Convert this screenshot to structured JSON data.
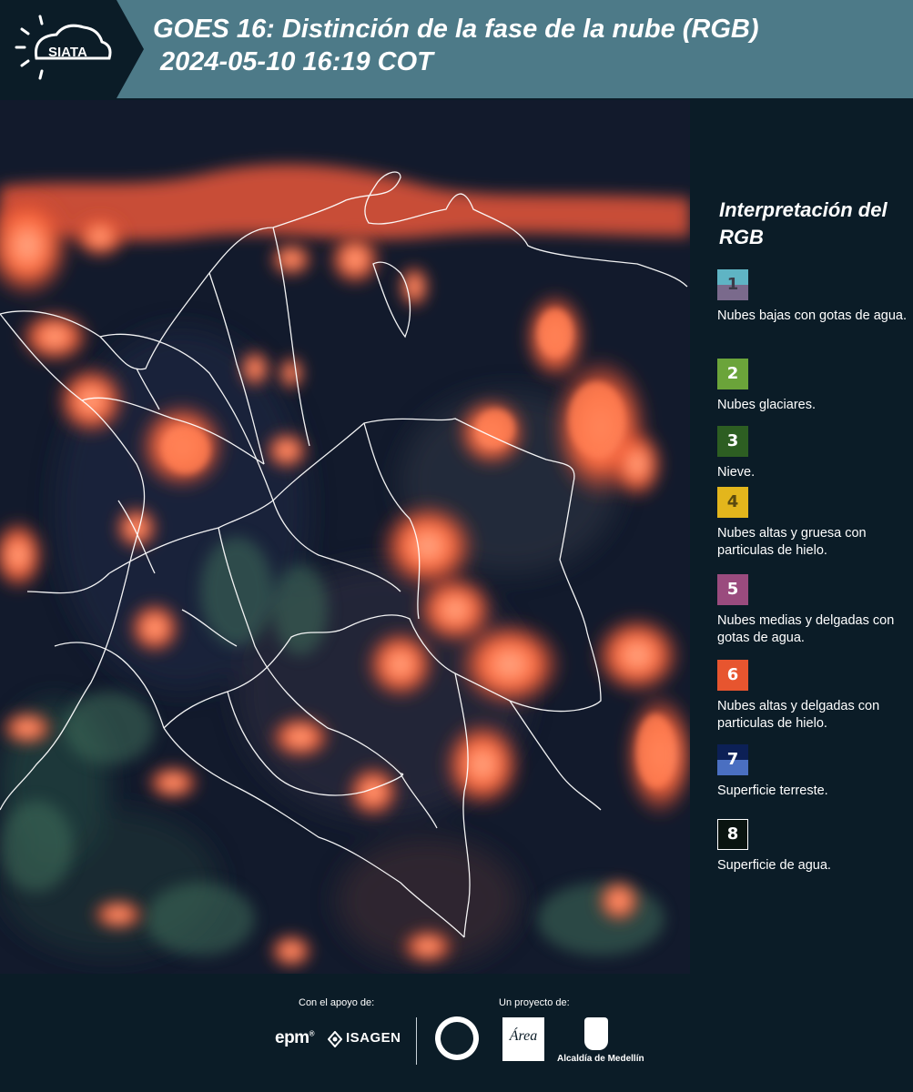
{
  "header": {
    "logo_text": "SIATA",
    "title_line1": "GOES 16: Distinción de la fase de la nube (RGB)",
    "title_line2": "2024-05-10 16:19 COT"
  },
  "legend": {
    "title": "Interpretación del RGB",
    "items": [
      {
        "number": "1",
        "label": "Nubes bajas con gotas de agua.",
        "colors": [
          "#5fb4c4",
          "#7a6a8c"
        ]
      },
      {
        "number": "2",
        "label": "Nubes glaciares.",
        "colors": [
          "#6ba43a"
        ]
      },
      {
        "number": "3",
        "label": "Nieve.",
        "colors": [
          "#2d5e22"
        ]
      },
      {
        "number": "4",
        "label": "Nubes altas y gruesa con particulas de hielo.",
        "colors": [
          "#e3b61c"
        ]
      },
      {
        "number": "5",
        "label": "Nubes medias y delgadas con gotas de agua.",
        "colors": [
          "#9a4b7e"
        ]
      },
      {
        "number": "6",
        "label": "Nubes altas y delgadas con particulas de hielo.",
        "colors": [
          "#e7552f"
        ]
      },
      {
        "number": "7",
        "label": "Superficie terreste.",
        "colors": [
          "#0c2056",
          "#4a6fc1"
        ]
      },
      {
        "number": "8",
        "label": "Superficie de agua.",
        "colors": [
          "#0a1410"
        ]
      }
    ]
  },
  "footer": {
    "support_label": "Con el apoyo de:",
    "project_label": "Un proyecto de:",
    "epm_text": "epm",
    "isagen_text": "ISAGEN",
    "alcaldia_text": "Alcaldía de Medellín",
    "area_text": "Área"
  },
  "colors": {
    "header_bg": "#4d7a88",
    "page_bg": "#0b1c27",
    "cloud_orange": "#ff5a32",
    "border_white": "#ffffff"
  }
}
